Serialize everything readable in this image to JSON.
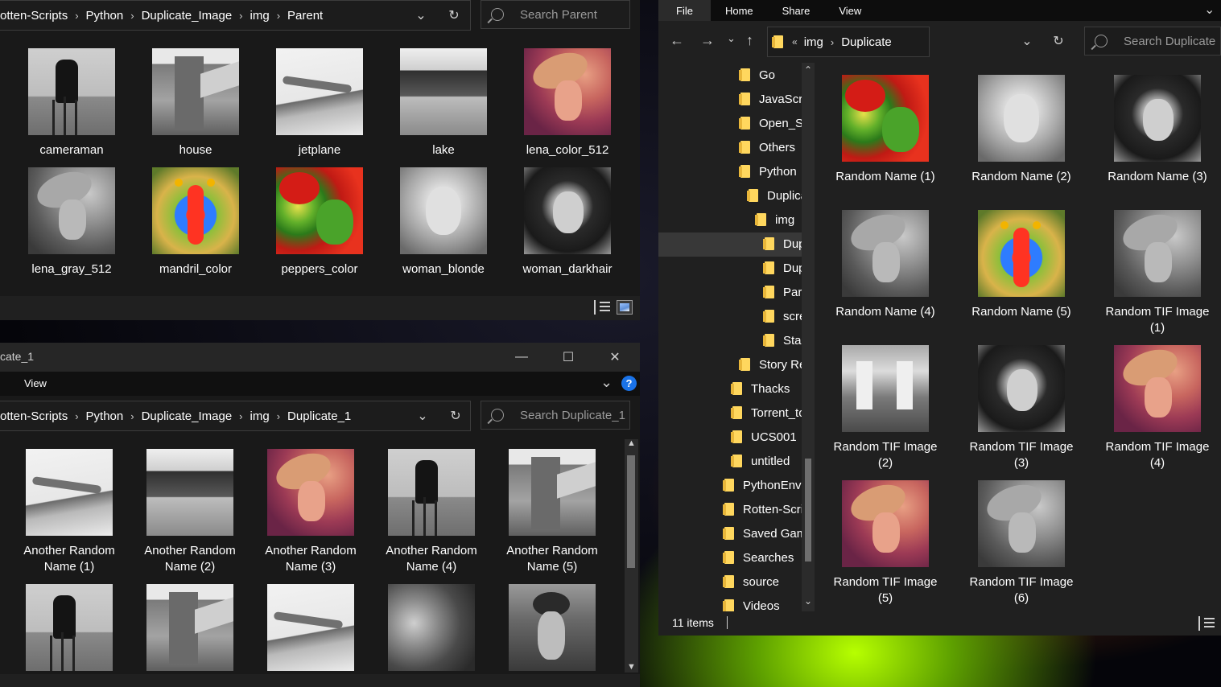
{
  "parent_window": {
    "breadcrumb": [
      "otten-Scripts",
      "Python",
      "Duplicate_Image",
      "img",
      "Parent"
    ],
    "search_placeholder": "Search Parent",
    "items": [
      {
        "label": "cameraman",
        "image": "cameraman"
      },
      {
        "label": "house",
        "image": "house"
      },
      {
        "label": "jetplane",
        "image": "jet"
      },
      {
        "label": "lake",
        "image": "lake"
      },
      {
        "label": "lena_color_512",
        "image": "lena"
      },
      {
        "label": "lena_gray_512",
        "image": "lenag"
      },
      {
        "label": "mandril_color",
        "image": "mandril"
      },
      {
        "label": "peppers_color",
        "image": "peppers"
      },
      {
        "label": "woman_blonde",
        "image": "blonde"
      },
      {
        "label": "woman_darkhair",
        "image": "dark"
      }
    ]
  },
  "duplicate1_window": {
    "title": "cate_1",
    "ribbon_tab": "View",
    "help_label": "?",
    "breadcrumb": [
      "otten-Scripts",
      "Python",
      "Duplicate_Image",
      "img",
      "Duplicate_1"
    ],
    "search_placeholder": "Search Duplicate_1",
    "items": [
      {
        "label": "Another Random Name (1)",
        "image": "jet"
      },
      {
        "label": "Another Random Name (2)",
        "image": "lake"
      },
      {
        "label": "Another Random Name (3)",
        "image": "lena"
      },
      {
        "label": "Another Random Name (4)",
        "image": "cameraman"
      },
      {
        "label": "Another Random Name (5)",
        "image": "house"
      },
      {
        "label": "",
        "image": "cameraman"
      },
      {
        "label": "",
        "image": "house"
      },
      {
        "label": "",
        "image": "jet"
      },
      {
        "label": "",
        "image": "peppersg"
      },
      {
        "label": "",
        "image": "woman2"
      }
    ]
  },
  "duplicate_window": {
    "tabs": [
      "File",
      "Home",
      "Share",
      "View"
    ],
    "breadcrumb": [
      "img",
      "Duplicate"
    ],
    "breadcrumb_overflow": "«",
    "search_placeholder": "Search Duplicate",
    "status_count": "11 items",
    "tree": [
      {
        "label": "Go",
        "indent": 1
      },
      {
        "label": "JavaScrip",
        "indent": 1
      },
      {
        "label": "Open_So",
        "indent": 1
      },
      {
        "label": "Others",
        "indent": 1
      },
      {
        "label": "Python",
        "indent": 1
      },
      {
        "label": "Duplica",
        "indent": 2
      },
      {
        "label": "img",
        "indent": 3
      },
      {
        "label": "Dup",
        "indent": 4,
        "selected": true
      },
      {
        "label": "Dup",
        "indent": 4
      },
      {
        "label": "Pare",
        "indent": 4
      },
      {
        "label": "scree",
        "indent": 4
      },
      {
        "label": "Stan",
        "indent": 4
      },
      {
        "label": "Story Rea",
        "indent": 1
      },
      {
        "label": "Thacks",
        "indent": 0
      },
      {
        "label": "Torrent_to",
        "indent": 0
      },
      {
        "label": "UCS001",
        "indent": 0
      },
      {
        "label": "untitled",
        "indent": 0
      },
      {
        "label": "PythonEnv",
        "indent": -1
      },
      {
        "label": "Rotten-Scrip",
        "indent": -1
      },
      {
        "label": "Saved Game",
        "indent": -1
      },
      {
        "label": "Searches",
        "indent": -1
      },
      {
        "label": "source",
        "indent": -1
      },
      {
        "label": "Videos",
        "indent": -1
      }
    ],
    "items": [
      {
        "label": "Random Name (1)",
        "image": "peppers"
      },
      {
        "label": "Random Name (2)",
        "image": "blonde"
      },
      {
        "label": "Random Name (3)",
        "image": "dark"
      },
      {
        "label": "Random Name (4)",
        "image": "lenag"
      },
      {
        "label": "Random Name (5)",
        "image": "mandril"
      },
      {
        "label": "Random TIF Image (1)",
        "image": "lenag"
      },
      {
        "label": "Random TIF Image (2)",
        "image": "room"
      },
      {
        "label": "Random TIF Image (3)",
        "image": "dark"
      },
      {
        "label": "Random TIF Image (4)",
        "image": "lena"
      },
      {
        "label": "Random TIF Image (5)",
        "image": "lena"
      },
      {
        "label": "Random TIF Image (6)",
        "image": "lenag"
      }
    ]
  },
  "colors": {
    "window_bg": "#191919",
    "accent_blue": "#1a73e8",
    "folder_yellow": "#ffd75e",
    "selection": "#383838"
  }
}
